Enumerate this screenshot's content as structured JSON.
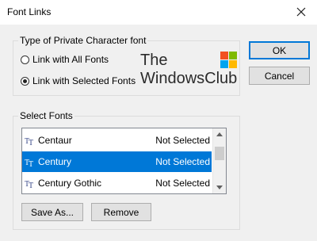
{
  "window": {
    "title": "Font Links"
  },
  "type_group": {
    "legend": "Type of Private Character font",
    "options": [
      {
        "label": "Link with All Fonts",
        "checked": false
      },
      {
        "label": "Link with Selected Fonts",
        "checked": true
      }
    ]
  },
  "logo": {
    "line1": "The",
    "line2": "WindowsClub"
  },
  "select_group": {
    "legend": "Select Fonts",
    "rows": [
      {
        "name": "Centaur",
        "status": "Not Selected",
        "selected": false
      },
      {
        "name": "Century",
        "status": "Not Selected",
        "selected": true
      },
      {
        "name": "Century Gothic",
        "status": "Not Selected",
        "selected": false
      }
    ]
  },
  "buttons": {
    "ok": "OK",
    "cancel": "Cancel",
    "save_as": "Save As...",
    "remove": "Remove"
  },
  "colors": {
    "accent": "#0078d7",
    "logo_squares": [
      "#f25022",
      "#7fba00",
      "#00a4ef",
      "#ffb900"
    ]
  }
}
